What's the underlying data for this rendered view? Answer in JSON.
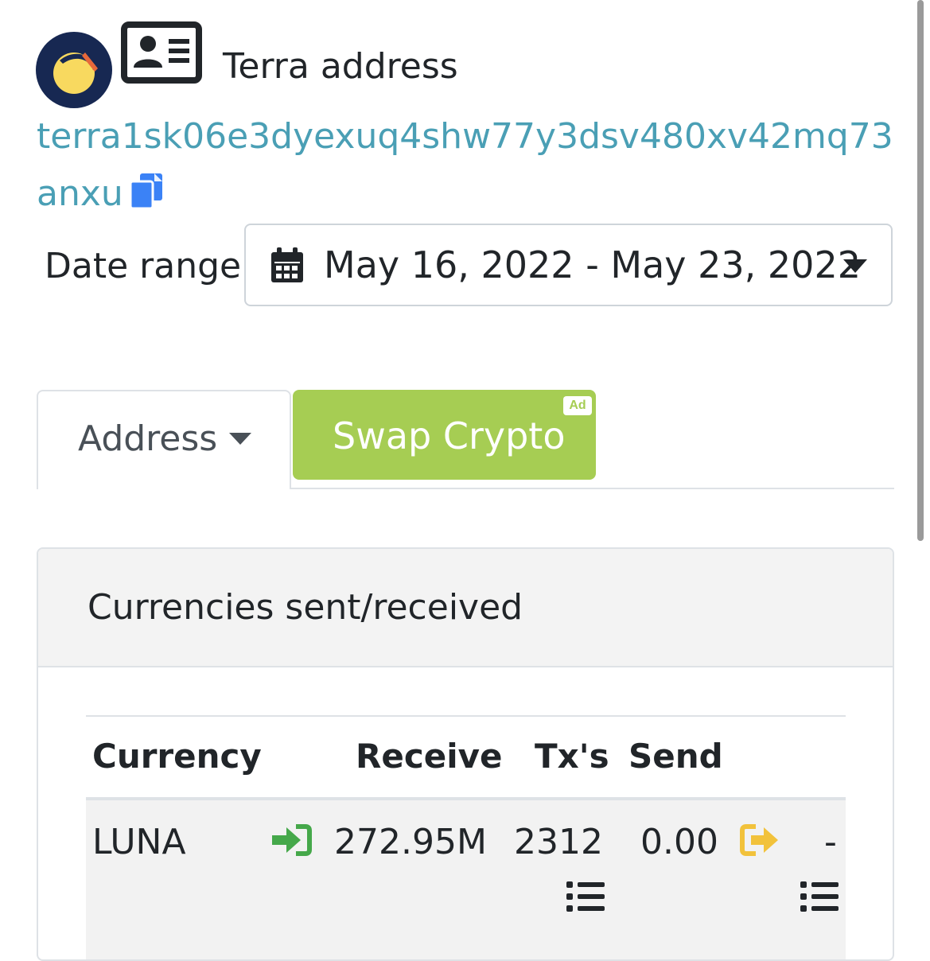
{
  "header": {
    "title": "Terra address",
    "address_line1": "terra1sk06e3dyexuq4shw77y3dsv480xv42mq73",
    "address_line2": "anxu",
    "logo_icon": "terra-luna-logo",
    "card_icon": "address-card-icon",
    "copy_icon": "copy-icon"
  },
  "date_range": {
    "label": "Date range",
    "value": "May 16, 2022 - May 23, 2022",
    "icon": "calendar-icon"
  },
  "tabs": {
    "address_label": "Address",
    "swap_label": "Swap Crypto",
    "ad_badge": "Ad",
    "swap_color": "#a6cd53"
  },
  "card": {
    "title": "Currencies sent/received",
    "columns": [
      "Currency",
      "Receive",
      "Tx's",
      "Send"
    ],
    "rows": [
      {
        "currency": "LUNA",
        "receive": "272.95M",
        "txs": "2312",
        "send": "0.00",
        "send_txs": "-"
      }
    ]
  },
  "colors": {
    "link": "#4a9fb5",
    "receive_icon": "#45a84a",
    "send_icon": "#f2c23b",
    "copy_icon": "#3b82f6",
    "logo_bg": "#172852",
    "logo_moon": "#f8d95f"
  }
}
